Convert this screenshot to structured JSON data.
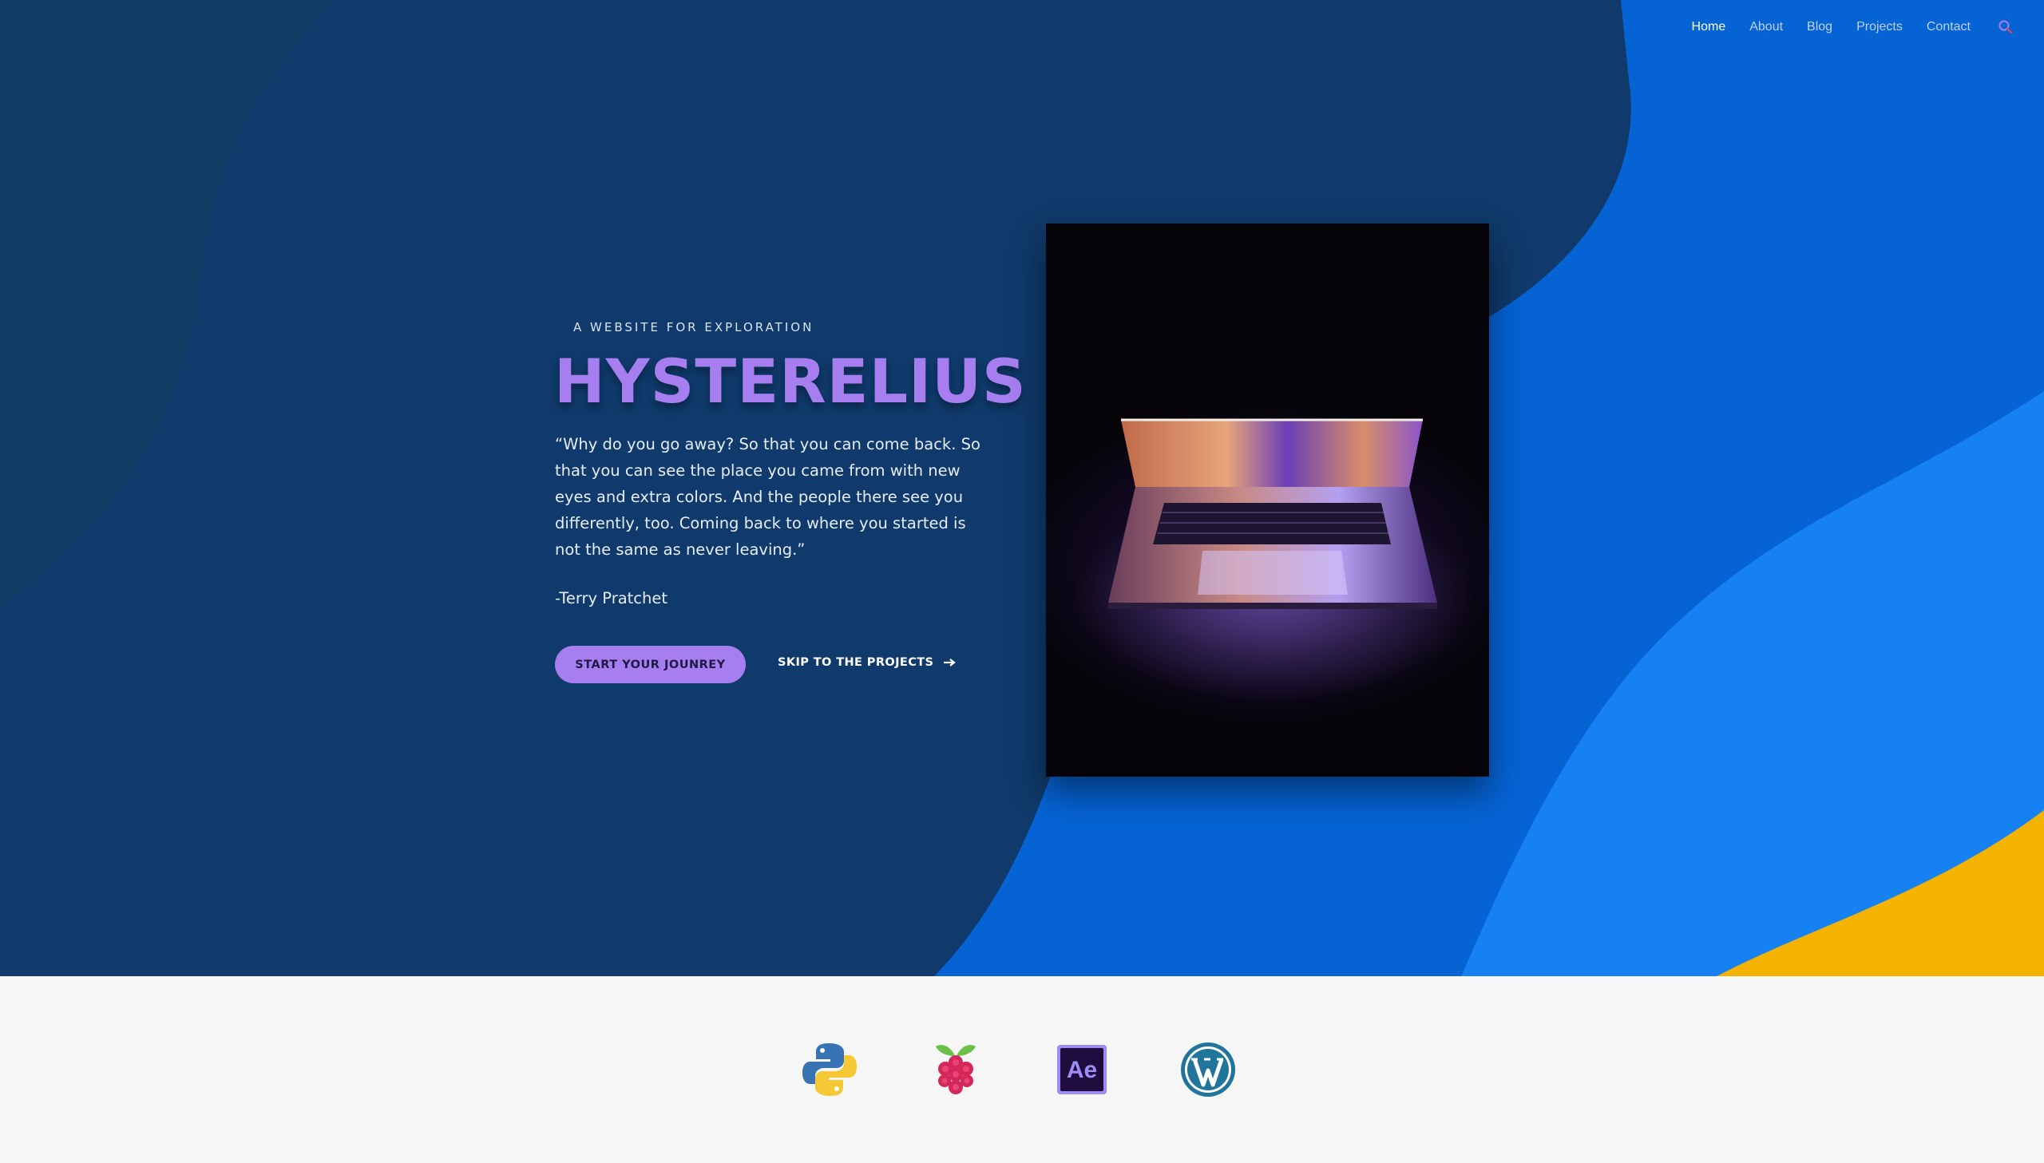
{
  "nav": {
    "items": [
      {
        "label": "Home",
        "active": true
      },
      {
        "label": "About",
        "active": false
      },
      {
        "label": "Blog",
        "active": false
      },
      {
        "label": "Projects",
        "active": false
      },
      {
        "label": "Contact",
        "active": false
      }
    ],
    "search_icon": "search-icon"
  },
  "hero": {
    "eyebrow": "A WEBSITE FOR EXPLORATION",
    "title": "HYSTERELIUS",
    "quote": "“Why do you go away? So that you can come back. So that you can see the place you came from with new eyes and extra colors. And the people there see you differently, too. Coming back to where you started is not the same as never leaving.”",
    "author": "-Terry Pratchet",
    "primary_button": "START YOUR JOUNREY",
    "secondary_button": "SKIP TO THE PROJECTS",
    "secondary_icon": "arrow-right-icon",
    "image": "laptop-photo"
  },
  "logos": [
    {
      "name": "python-logo"
    },
    {
      "name": "raspberry-pi-logo"
    },
    {
      "name": "after-effects-logo",
      "text": "Ae"
    },
    {
      "name": "wordpress-logo"
    }
  ],
  "colors": {
    "hero_dark": "#0f3a6b",
    "hero_mid": "#0563d4",
    "hero_light": "#1681f3",
    "accent_yellow": "#f5b301",
    "accent_purple": "#a77ef0",
    "strip_bg": "#f6f6f6"
  }
}
